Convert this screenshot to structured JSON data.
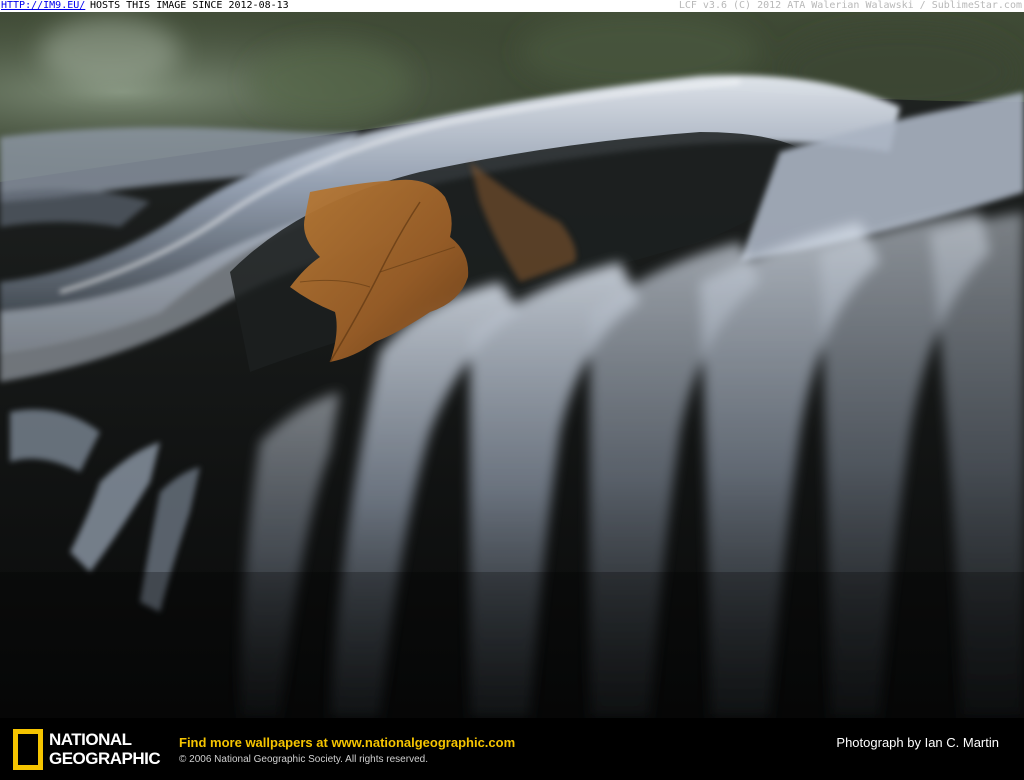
{
  "top_banner": {
    "link_text": "HTTP://IM9.EU/",
    "hosts_text": "HOSTS THIS IMAGE SINCE 2012-08-13",
    "credit_text": "LCF v3.6 (C) 2012 ATA Walerian Walawski / SublimeStar.com"
  },
  "photo": {
    "subject_icon": "waterfall-photo"
  },
  "footer": {
    "logo": {
      "line1": "NATIONAL",
      "line2": "GEOGRAPHIC",
      "box_color": "#f5c400"
    },
    "find_more_prefix": "Find more wallpapers at ",
    "find_more_url": "www.nationalgeographic.com",
    "copyright": "© 2006 National Geographic Society. All rights reserved.",
    "photo_credit": "Photograph by Ian C. Martin"
  }
}
